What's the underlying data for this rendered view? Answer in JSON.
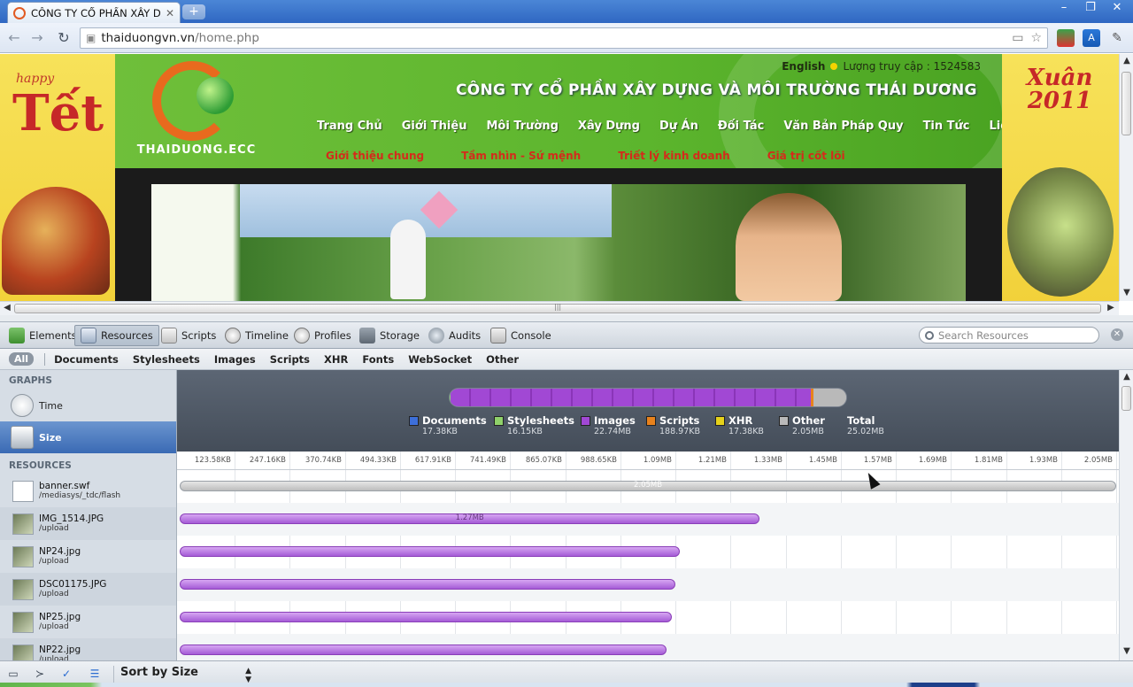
{
  "browser": {
    "tab_title": "CÔNG TY CỔ PHẦN XÂY D...",
    "url_host": "thaiduongvn.vn",
    "url_path": "/home.php"
  },
  "site": {
    "lang_link": "English",
    "visit_counter": "Lượng truy cập : 1524583",
    "company_name": "CÔNG TY CỔ PHẦN XÂY DỰNG VÀ MÔI TRƯỜNG THÁI DƯƠNG",
    "brand": "THAIDUONG.ECC",
    "left_happy": "happy",
    "left_tet": "Tết",
    "right_xuan": "Xuân 2011",
    "main_nav": [
      "Trang Chủ",
      "Giới Thiệu",
      "Môi Trường",
      "Xây Dựng",
      "Dự Án",
      "Đối Tác",
      "Văn Bản Pháp Quy",
      "Tin Tức",
      "Liên Hệ"
    ],
    "sub_nav": [
      "Giới thiệu chung",
      "Tầm nhìn - Sứ mệnh",
      "Triết lý kinh doanh",
      "Giá trị cốt lõi"
    ]
  },
  "devtools": {
    "panels": [
      "Elements",
      "Resources",
      "Scripts",
      "Timeline",
      "Profiles",
      "Storage",
      "Audits",
      "Console"
    ],
    "active_panel": "Resources",
    "search_placeholder": "Search Resources",
    "filters": [
      "All",
      "Documents",
      "Stylesheets",
      "Images",
      "Scripts",
      "XHR",
      "Fonts",
      "WebSocket",
      "Other"
    ],
    "sidebar": {
      "graphs_header": "GRAPHS",
      "time_label": "Time",
      "size_label": "Size",
      "resources_header": "RESOURCES"
    },
    "sort_label": "Sort by Size"
  },
  "chart_data": {
    "type": "bar",
    "title": "",
    "unit": "MB",
    "summary": {
      "categories": [
        {
          "name": "Documents",
          "value_label": "17.38KB",
          "value": 0.017,
          "color": "#3d6fd9"
        },
        {
          "name": "Stylesheets",
          "value_label": "16.15KB",
          "value": 0.016,
          "color": "#8fd16a"
        },
        {
          "name": "Images",
          "value_label": "22.74MB",
          "value": 22.74,
          "color": "#a148d4"
        },
        {
          "name": "Scripts",
          "value_label": "188.97KB",
          "value": 0.185,
          "color": "#e8821c"
        },
        {
          "name": "XHR",
          "value_label": "17.38KB",
          "value": 0.017,
          "color": "#e6d21a"
        },
        {
          "name": "Other",
          "value_label": "2.05MB",
          "value": 2.05,
          "color": "#b9b9b9"
        }
      ],
      "total_label": "Total",
      "total_value": "25.02MB"
    },
    "axis_ticks": [
      "123.58KB",
      "247.16KB",
      "370.74KB",
      "494.33KB",
      "617.91KB",
      "741.49KB",
      "865.07KB",
      "988.65KB",
      "1.09MB",
      "1.21MB",
      "1.33MB",
      "1.45MB",
      "1.57MB",
      "1.69MB",
      "1.81MB",
      "1.93MB",
      "2.05MB"
    ],
    "xlim": [
      0,
      2.05
    ],
    "resources": [
      {
        "name": "banner.swf",
        "path": "/mediasys/_tdc/flash",
        "size": 2.05,
        "size_label": "2.05MB",
        "kind": "other"
      },
      {
        "name": "IMG_1514.JPG",
        "path": "/upload",
        "size": 1.27,
        "size_label": "1.27MB",
        "kind": "image"
      },
      {
        "name": "NP24.jpg",
        "path": "/upload",
        "size": 1.095,
        "size_label": "",
        "kind": "image"
      },
      {
        "name": "DSC01175.JPG",
        "path": "/upload",
        "size": 1.085,
        "size_label": "",
        "kind": "image"
      },
      {
        "name": "NP25.jpg",
        "path": "/upload",
        "size": 1.078,
        "size_label": "",
        "kind": "image"
      },
      {
        "name": "NP22.jpg",
        "path": "/upload",
        "size": 1.065,
        "size_label": "",
        "kind": "image"
      }
    ]
  }
}
